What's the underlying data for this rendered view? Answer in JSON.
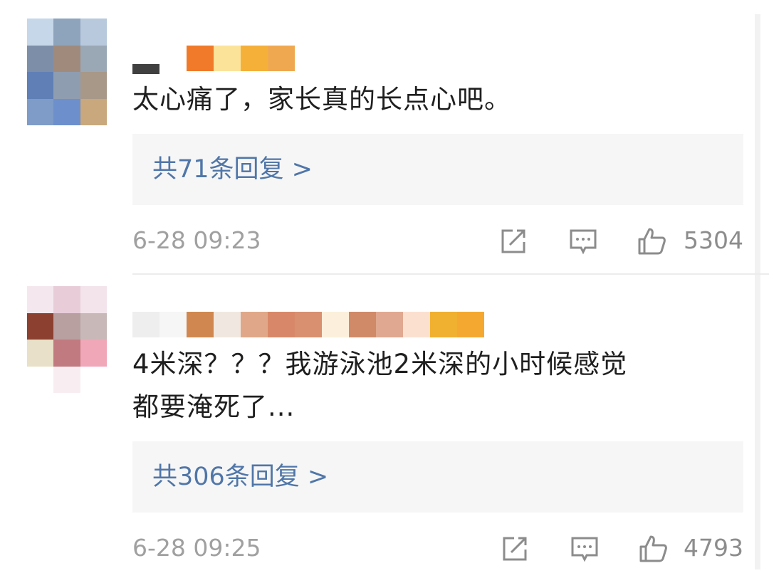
{
  "comments": [
    {
      "text": "太心痛了，家长真的长点心吧。",
      "replies": "共71条回复 >",
      "time": "6-28 09:23",
      "likes": "5304"
    },
    {
      "text": "4米深？？？我游泳池2米深的小时候感觉\n都要淹死了...",
      "replies": "共306条回复 >",
      "time": "6-28 09:25",
      "likes": "4793"
    }
  ],
  "icons": [
    "share-icon",
    "comment-icon",
    "like-icon"
  ]
}
